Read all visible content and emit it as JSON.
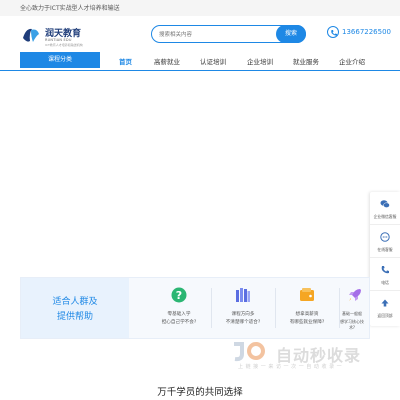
{
  "topbar": {
    "slogan": "全心致力于ICT实战型人才培养和输送"
  },
  "logo": {
    "title": "润天教育",
    "subtitle": "RUNTIAN EDU",
    "tagline": "ICT教育人才培养和输送机构"
  },
  "search": {
    "placeholder": "搜索相关内容",
    "button": "搜索"
  },
  "contact": {
    "phone": "13667226500"
  },
  "nav": {
    "category": "课程分类",
    "items": [
      {
        "label": "首页",
        "active": true
      },
      {
        "label": "高薪就业"
      },
      {
        "label": "认证培训"
      },
      {
        "label": "企业培训"
      },
      {
        "label": "就业服务"
      },
      {
        "label": "企业介绍"
      }
    ]
  },
  "sidebar": {
    "items": [
      {
        "label": "企业微信客服",
        "icon": "wechat-icon"
      },
      {
        "label": "在线客服",
        "icon": "chat-icon"
      },
      {
        "label": "电话",
        "icon": "phone-icon"
      },
      {
        "label": "返回顶部",
        "icon": "arrow-up-icon"
      }
    ]
  },
  "help": {
    "title_line1": "适合人群及",
    "title_line2": "提供帮助",
    "items": [
      {
        "line1": "零基础入学",
        "line2": "担心自己学不会?",
        "icon": "question-icon",
        "color": "#2bb673"
      },
      {
        "line1": "课程方向多",
        "line2": "不清楚哪个适合?",
        "icon": "books-icon",
        "color": "#5b6ee1"
      },
      {
        "line1": "想拿高薪资",
        "line2": "有哪些就业保障?",
        "icon": "wallet-icon",
        "color": "#f5a623"
      },
      {
        "line1": "基础一般般",
        "line2": "想学习核心技术?",
        "icon": "rocket-icon",
        "color": "#a56ee8"
      }
    ]
  },
  "watermark": {
    "big": "自动秒收录",
    "small": "上 链 接 一 来 访 一 次 一 自 动 收 录 一"
  },
  "section": {
    "title": "万千学员的共同选择"
  },
  "colors": {
    "primary": "#1e88e5"
  }
}
